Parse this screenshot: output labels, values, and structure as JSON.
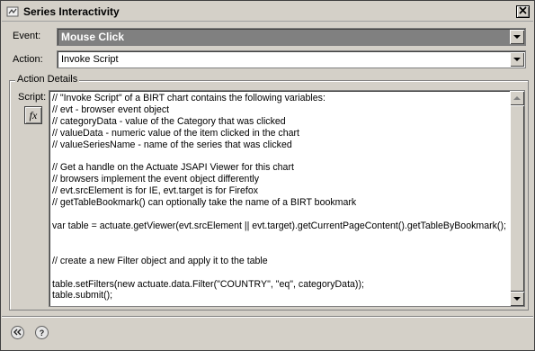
{
  "window": {
    "title": "Series Interactivity",
    "icon": "series-interactivity-icon",
    "close_icon": "close-icon"
  },
  "event": {
    "label": "Event:",
    "value": "Mouse Click"
  },
  "action": {
    "label": "Action:",
    "value": "Invoke Script"
  },
  "details": {
    "group_title": "Action Details",
    "script_label": "Script:",
    "fx_label": "fx",
    "script_lines": [
      "// \"Invoke Script\" of a BIRT chart contains the following variables:",
      "// evt - browser event object",
      "// categoryData - value of the Category that was clicked",
      "// valueData - numeric value of the item clicked in the chart",
      "// valueSeriesName - name of the series that was clicked",
      "",
      "// Get a handle on the Actuate JSAPI Viewer for this chart",
      "// browsers implement the event object differently",
      "// evt.srcElement is for IE, evt.target is for Firefox",
      "// getTableBookmark() can optionally take the name of a BIRT bookmark",
      "",
      "var table = actuate.getViewer(evt.srcElement || evt.target).getCurrentPageContent().getTableByBookmark();",
      "",
      "",
      "// create a new Filter object and apply it to the table",
      "",
      "table.setFilters(new actuate.data.Filter(\"COUNTRY\", \"eq\", categoryData));",
      "table.submit();"
    ]
  },
  "footer": {
    "back_icon": "double-chevron-left-icon",
    "help_icon": "help-icon"
  }
}
